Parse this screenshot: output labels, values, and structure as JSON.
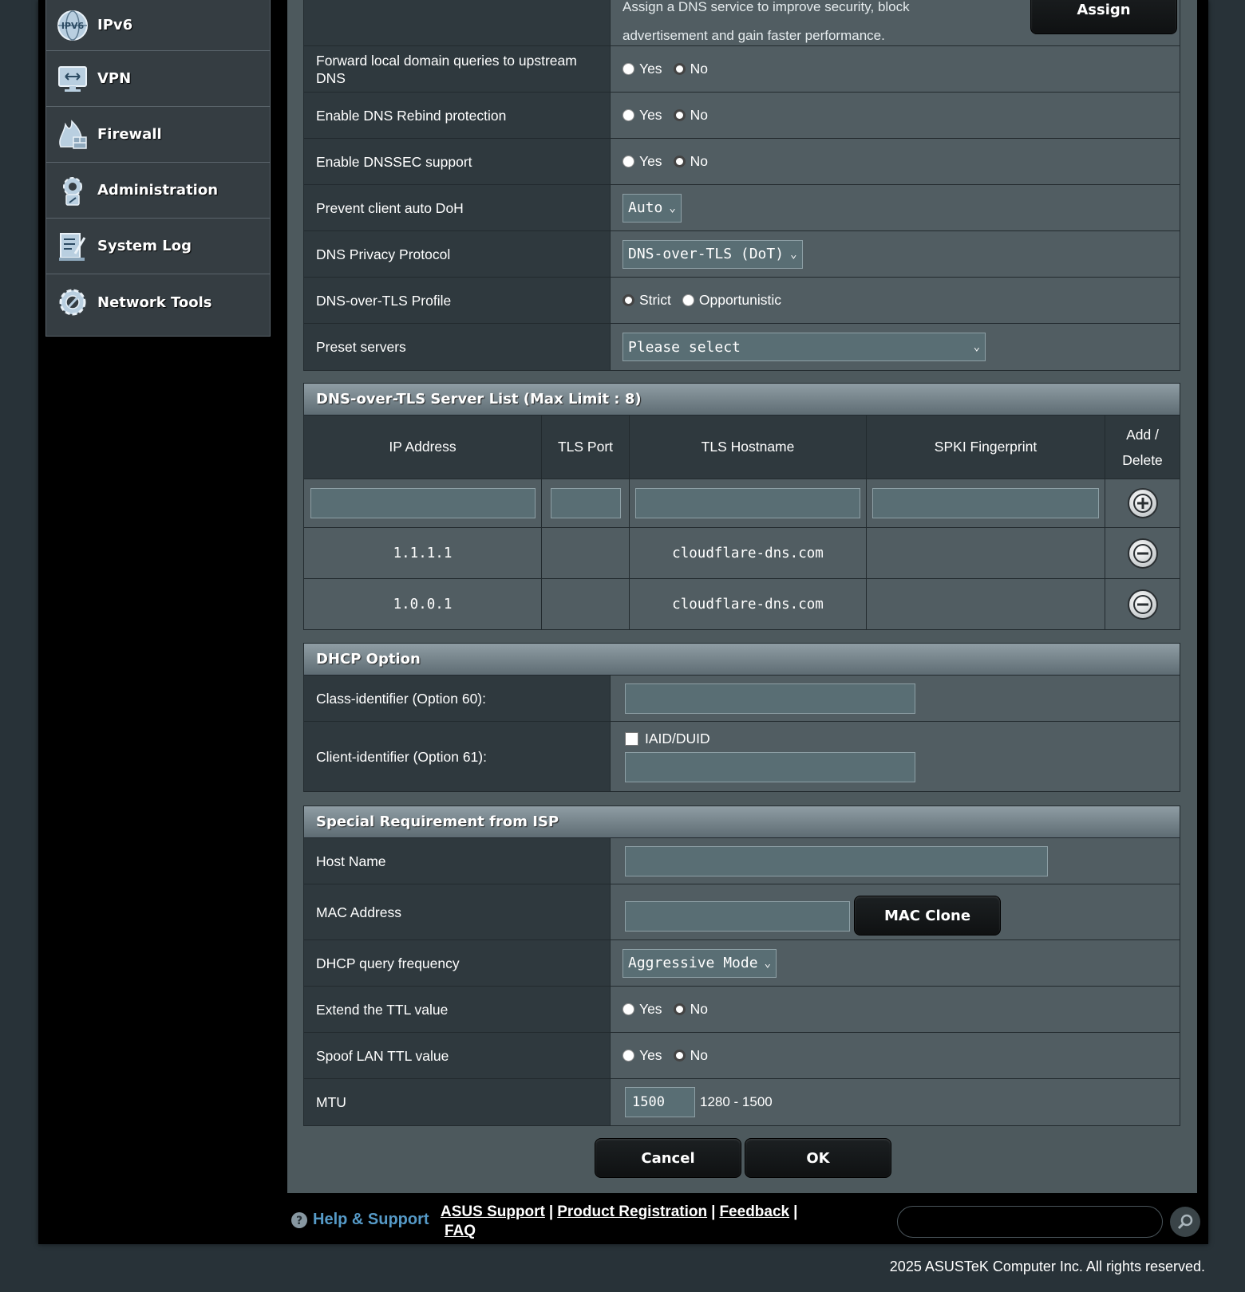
{
  "sidebar": {
    "items": [
      {
        "label": "IPv6",
        "icon": "ipv6-globe-icon"
      },
      {
        "label": "VPN",
        "icon": "vpn-monitor-icon"
      },
      {
        "label": "Firewall",
        "icon": "firewall-icon"
      },
      {
        "label": "Administration",
        "icon": "administration-gear-icon"
      },
      {
        "label": "System Log",
        "icon": "system-log-icon"
      },
      {
        "label": "Network Tools",
        "icon": "network-tools-icon"
      }
    ]
  },
  "dns": {
    "assign_text_1": "Assign a DNS service to improve security, block",
    "assign_text_2": "advertisement and gain faster performance.",
    "assign_button": "Assign",
    "forward_label": "Forward local domain queries to upstream DNS",
    "rebind_label": "Enable DNS Rebind protection",
    "dnssec_label": "Enable DNSSEC support",
    "yes": "Yes",
    "no": "No",
    "doh_label": "Prevent client auto DoH",
    "doh_value": "Auto",
    "privacy_label": "DNS Privacy Protocol",
    "privacy_value": "DNS-over-TLS (DoT)",
    "profile_label": "DNS-over-TLS Profile",
    "profile_strict": "Strict",
    "profile_opportunistic": "Opportunistic",
    "preset_label": "Preset servers",
    "preset_value": "Please select"
  },
  "dot_list": {
    "title": "DNS-over-TLS Server List (Max Limit : 8)",
    "col_ip": "IP Address",
    "col_port": "TLS Port",
    "col_host": "TLS Hostname",
    "col_spki": "SPKI Fingerprint",
    "col_action_1": "Add /",
    "col_action_2": "Delete",
    "rows": [
      {
        "ip": "1.1.1.1",
        "port": "",
        "host": "cloudflare-dns.com",
        "spki": ""
      },
      {
        "ip": "1.0.0.1",
        "port": "",
        "host": "cloudflare-dns.com",
        "spki": ""
      }
    ]
  },
  "dhcp": {
    "title": "DHCP Option",
    "class_label": "Class-identifier (Option 60):",
    "client_label": "Client-identifier (Option 61):",
    "iaid_label": "IAID/DUID"
  },
  "isp": {
    "title": "Special Requirement from ISP",
    "host_label": "Host Name",
    "mac_label": "MAC Address",
    "mac_clone": "MAC Clone",
    "freq_label": "DHCP query frequency",
    "freq_value": "Aggressive Mode",
    "ttl_label": "Extend the TTL value",
    "spoof_label": "Spoof LAN TTL value",
    "mtu_label": "MTU",
    "mtu_value": "1500",
    "mtu_range": "1280 - 1500"
  },
  "actions": {
    "cancel": "Cancel",
    "ok": "OK"
  },
  "footer": {
    "help": "Help & Support",
    "links": [
      "ASUS Support",
      "Product Registration",
      "Feedback",
      "FAQ"
    ],
    "copyright": "2025 ASUSTeK Computer Inc. All rights reserved."
  },
  "colors": {
    "background": "#283238",
    "panel": "#4d595d",
    "header_cell": "#2f393e",
    "help_blue": "#569ac7"
  }
}
